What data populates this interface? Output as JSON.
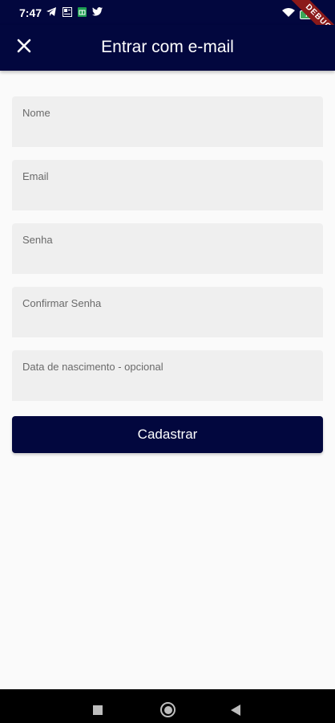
{
  "status_bar": {
    "time": "7:47",
    "battery": "74",
    "debug": "DEBUG",
    "left_icons": [
      "telegram-icon",
      "news-icon",
      "sheets-icon",
      "twitter-icon"
    ],
    "right_icons": [
      "wifi-icon",
      "battery-icon"
    ]
  },
  "app_bar": {
    "title": "Entrar com e-mail",
    "close_icon": "close-icon"
  },
  "form": {
    "fields": [
      {
        "label": "Nome",
        "value": ""
      },
      {
        "label": "Email",
        "value": ""
      },
      {
        "label": "Senha",
        "value": ""
      },
      {
        "label": "Confirmar Senha",
        "value": ""
      },
      {
        "label": "Data de nascimento - opcional",
        "value": ""
      }
    ],
    "submit_label": "Cadastrar"
  },
  "nav_bar": {
    "icons": [
      "recents-icon",
      "home-icon",
      "back-icon"
    ]
  },
  "colors": {
    "primary": "#02073e",
    "field_bg": "#efefef",
    "background": "#fafafa"
  }
}
